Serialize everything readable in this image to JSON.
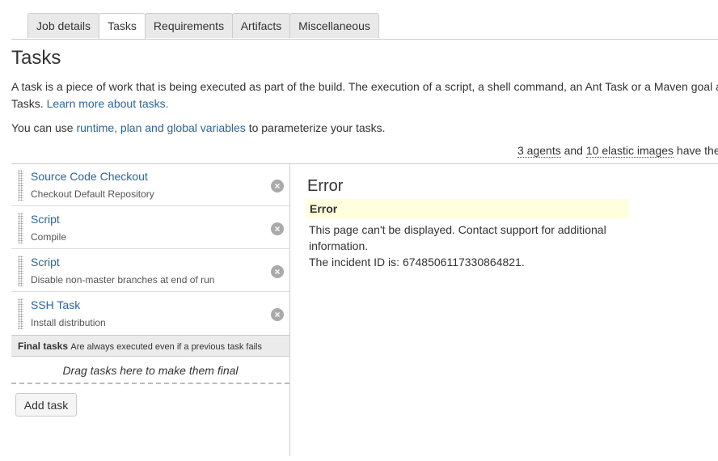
{
  "tabs": [
    {
      "label": "Job details",
      "active": false
    },
    {
      "label": "Tasks",
      "active": true
    },
    {
      "label": "Requirements",
      "active": false
    },
    {
      "label": "Artifacts",
      "active": false
    },
    {
      "label": "Miscellaneous",
      "active": false
    }
  ],
  "page": {
    "title": "Tasks",
    "desc_line1": "A task is a piece of work that is being executed as part of the build. The execution of a script, a shell command, an Ant Task or a Maven goal a",
    "desc_line2_prefix": "Tasks. ",
    "desc_line2_link": "Learn more about tasks.",
    "vars_prefix": "You can use ",
    "vars_link": "runtime, plan and global variables",
    "vars_suffix": " to parameterize your tasks.",
    "agents_count": "3 agents",
    "agents_and": " and ",
    "agents_images": "10 elastic images",
    "agents_suffix": " have the"
  },
  "tasks": [
    {
      "name": "Source Code Checkout",
      "description": "Checkout Default Repository"
    },
    {
      "name": "Script",
      "description": "Compile"
    },
    {
      "name": "Script",
      "description": "Disable non-master branches at end of run"
    },
    {
      "name": "SSH Task",
      "description": "Install distribution"
    }
  ],
  "final_tasks": {
    "label": "Final tasks",
    "note": "Are always executed even if a previous task fails",
    "drop_hint": "Drag tasks here to make them final"
  },
  "add_task_label": "Add task",
  "error": {
    "title": "Error",
    "box_label": "Error",
    "message_line1": "This page can't be displayed. Contact support for additional information.",
    "message_line2": "The incident ID is: 6748506117330864821."
  },
  "icons": {
    "remove": "remove-circle-icon",
    "grip": "drag-handle-icon"
  },
  "colors": {
    "link": "#2a67a5",
    "error_box": "#ffffdd",
    "final_bar": "#ebebeb"
  }
}
